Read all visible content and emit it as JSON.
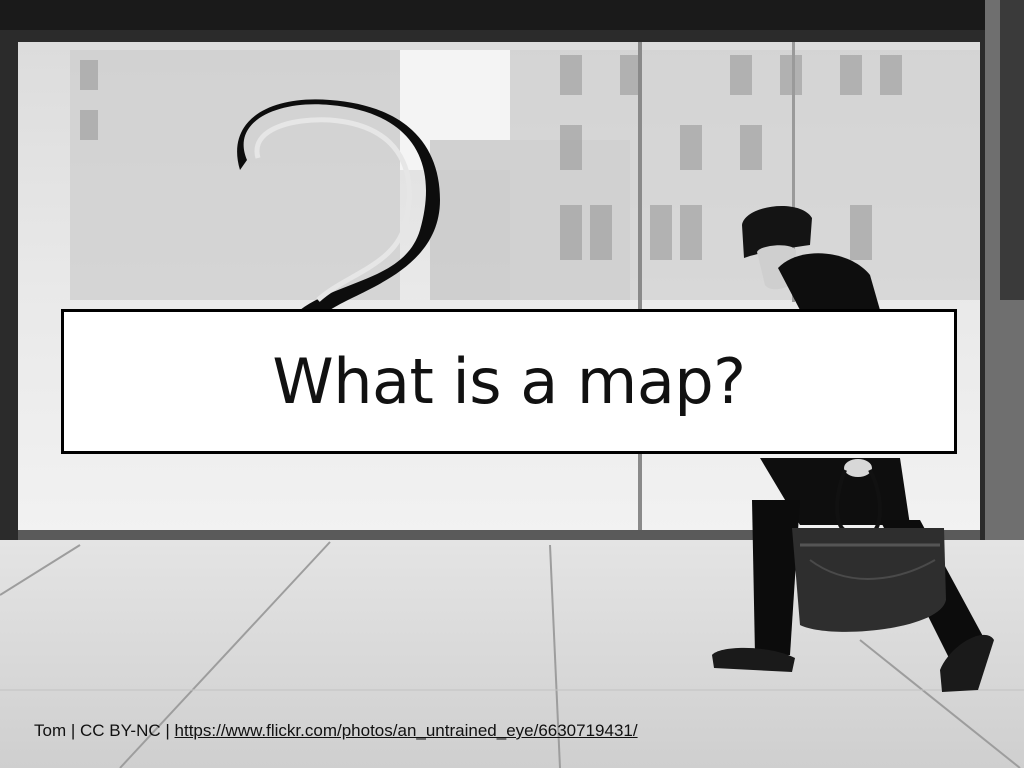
{
  "slide": {
    "title": "What is a map?"
  },
  "credit": {
    "author": "Tom",
    "separator": "|",
    "license": "CC BY-NC",
    "url": "https://www.flickr.com/photos/an_untrained_eye/6630719431/"
  },
  "photo": {
    "description_icons": [
      "question-mark-sign",
      "walking-man",
      "tote-bag"
    ],
    "palette": {
      "sky": "#e8e8e8",
      "wall": "#2a2a2a",
      "sidewalk": "#d6d6d6",
      "ink": "#0d0d0d"
    }
  }
}
